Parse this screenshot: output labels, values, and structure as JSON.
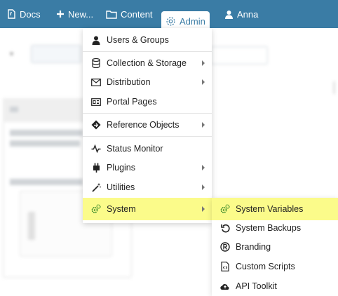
{
  "topbar": {
    "color": "#3a7ca5",
    "items": [
      {
        "label": "Docs",
        "icon": "docs-icon"
      },
      {
        "label": "New...",
        "icon": "plus-icon"
      },
      {
        "label": "Content",
        "icon": "folder-icon"
      },
      {
        "label": "Admin",
        "icon": "gear-icon",
        "active": true
      },
      {
        "label": "Anna",
        "icon": "user-icon"
      }
    ]
  },
  "admin_menu": {
    "items": [
      {
        "label": "Users & Groups",
        "icon": "users-icon",
        "submenu": false
      },
      {
        "label": "Collection & Storage",
        "icon": "database-icon",
        "submenu": true
      },
      {
        "label": "Distribution",
        "icon": "envelope-icon",
        "submenu": true
      },
      {
        "label": "Portal Pages",
        "icon": "portal-icon",
        "submenu": false
      },
      {
        "label": "Reference Objects",
        "icon": "diamond-arrow-icon",
        "submenu": true
      },
      {
        "label": "Status Monitor",
        "icon": "pulse-icon",
        "submenu": false
      },
      {
        "label": "Plugins",
        "icon": "plug-icon",
        "submenu": true
      },
      {
        "label": "Utilities",
        "icon": "wand-icon",
        "submenu": true
      },
      {
        "label": "System",
        "icon": "cogs-icon",
        "submenu": true,
        "highlighted": true
      }
    ]
  },
  "system_menu": {
    "items": [
      {
        "label": "System Variables",
        "icon": "cogs-icon",
        "highlighted": true
      },
      {
        "label": "System Backups",
        "icon": "backup-icon"
      },
      {
        "label": "Branding",
        "icon": "registered-icon"
      },
      {
        "label": "Custom Scripts",
        "icon": "script-icon"
      },
      {
        "label": "API Toolkit",
        "icon": "cloud-icon"
      }
    ]
  },
  "highlight_color": "#fbfb8a"
}
